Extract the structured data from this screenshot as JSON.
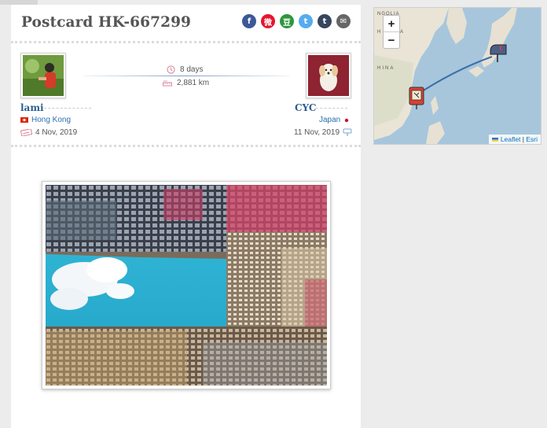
{
  "title": "Postcard HK-667299",
  "share_buttons": [
    {
      "icon": "facebook-icon",
      "glyph": "f",
      "color": "#3b5998"
    },
    {
      "icon": "weibo-icon",
      "glyph": "微",
      "color": "#e6162d"
    },
    {
      "icon": "douban-icon",
      "glyph": "豆",
      "color": "#2e963d"
    },
    {
      "icon": "twitter-icon",
      "glyph": "t",
      "color": "#55acee"
    },
    {
      "icon": "tumblr-icon",
      "glyph": "t",
      "color": "#36465d"
    },
    {
      "icon": "email-icon",
      "glyph": "✉",
      "color": "#666666"
    }
  ],
  "travel": {
    "days": "8 days",
    "distance": "2,881 km"
  },
  "sender": {
    "name": "lami",
    "country": "Hong Kong",
    "sent_date": "4 Nov, 2019"
  },
  "receiver": {
    "name": "CYC",
    "country": "Japan",
    "received_date": "11 Nov, 2019"
  },
  "map": {
    "zoom_in": "+",
    "zoom_out": "−",
    "attribution_leaflet": "Leaflet",
    "attribution_sep": " | ",
    "attribution_esri": "Esri",
    "labels": [
      "NGOLIA",
      "H KOREA",
      "HINA"
    ]
  },
  "colors": {
    "accent_blue": "#2c5f8f",
    "route_line": "#3e6fa8"
  }
}
